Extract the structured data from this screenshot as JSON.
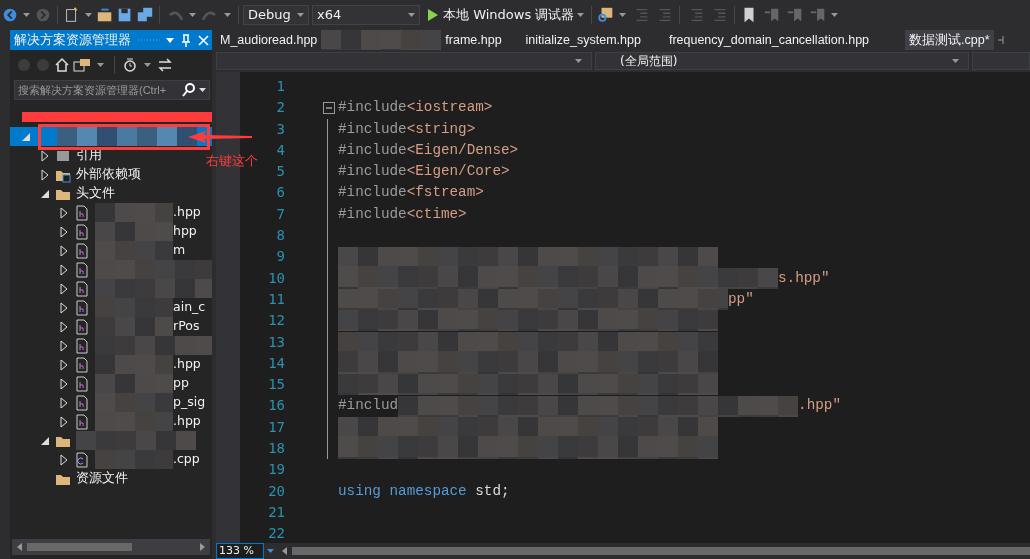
{
  "toolbar": {
    "configuration": "Debug",
    "platform": "x64",
    "run_label": "本地 Windows 调试器"
  },
  "solution_explorer": {
    "title": "解决方案资源管理器",
    "search": {
      "placeholder": "搜索解决方案资源管理器(Ctrl+"
    },
    "tree": [
      {
        "redacted": true,
        "selected": true,
        "expanded": true,
        "kind": "project",
        "children": [
          {
            "label": "引用",
            "kind": "references",
            "expanded": false,
            "selected": false
          },
          {
            "label": "外部依赖项",
            "kind": "external",
            "expanded": false,
            "selected": false
          },
          {
            "label": "头文件",
            "kind": "folder",
            "expanded": true,
            "selected": false,
            "children": [
              {
                "redacted": true,
                "suffix": ".hpp",
                "kind": "header",
                "expanded": false,
                "selected": false
              },
              {
                "redacted": true,
                "suffix": "hpp",
                "kind": "header",
                "expanded": false,
                "selected": false
              },
              {
                "redacted": true,
                "suffix": "m",
                "kind": "header",
                "expanded": false,
                "selected": false
              },
              {
                "redacted": true,
                "kind": "header",
                "expanded": false,
                "selected": false
              },
              {
                "redacted": true,
                "kind": "header",
                "expanded": false,
                "selected": false
              },
              {
                "redacted": true,
                "suffix": "ain_c",
                "kind": "header",
                "expanded": false,
                "selected": false
              },
              {
                "redacted": true,
                "suffix": "rPos",
                "kind": "header",
                "expanded": false,
                "selected": false
              },
              {
                "redacted": true,
                "kind": "header",
                "expanded": false,
                "selected": false
              },
              {
                "redacted": true,
                "suffix": ".hpp",
                "kind": "header",
                "expanded": false,
                "selected": false
              },
              {
                "redacted": true,
                "suffix": "pp",
                "kind": "header",
                "expanded": false,
                "selected": false
              },
              {
                "redacted": true,
                "suffix": "p_sig",
                "kind": "header",
                "expanded": false,
                "selected": false
              },
              {
                "redacted": true,
                "suffix": ".hpp",
                "kind": "header",
                "expanded": false,
                "selected": false
              }
            ]
          },
          {
            "redacted": true,
            "kind": "folder",
            "expanded": true,
            "selected": false,
            "children": [
              {
                "redacted": true,
                "suffix": ".cpp",
                "kind": "source",
                "expanded": false,
                "selected": false
              }
            ]
          },
          {
            "label": "资源文件",
            "kind": "folder",
            "selected": false
          }
        ]
      }
    ]
  },
  "annotation": {
    "text": "右键这个"
  },
  "tabs": [
    {
      "label": "M_audioread.hpp",
      "selected": false
    },
    {
      "label": "frame.hpp",
      "redacted": true,
      "selected": false
    },
    {
      "label": "initialize_system.hpp",
      "selected": false
    },
    {
      "label": "frequency_domain_cancellation.hpp",
      "selected": false
    },
    {
      "label": "数据测试.cpp*",
      "selected": true
    }
  ],
  "nav_bar": {
    "scope": "(全局范围)"
  },
  "code_lines": [
    {
      "number": "1",
      "kind": "plain"
    },
    {
      "number": "2",
      "kind": "fold-start",
      "tokens": [
        {
          "kind": "directive",
          "text": "#include"
        },
        {
          "kind": "string",
          "text": "<iostream>"
        }
      ]
    },
    {
      "number": "3",
      "kind": "fold-body",
      "tokens": [
        {
          "kind": "directive",
          "text": "#include"
        },
        {
          "kind": "string",
          "text": "<string>"
        }
      ]
    },
    {
      "number": "4",
      "kind": "fold-body",
      "tokens": [
        {
          "kind": "directive",
          "text": "#include"
        },
        {
          "kind": "string",
          "text": "<Eigen/Dense>"
        }
      ]
    },
    {
      "number": "5",
      "kind": "fold-body",
      "tokens": [
        {
          "kind": "directive",
          "text": "#include"
        },
        {
          "kind": "string",
          "text": "<Eigen/Core>"
        }
      ]
    },
    {
      "number": "6",
      "kind": "fold-body",
      "tokens": [
        {
          "kind": "directive",
          "text": "#include"
        },
        {
          "kind": "string",
          "text": "<fstream>"
        }
      ]
    },
    {
      "number": "7",
      "kind": "fold-body",
      "tokens": [
        {
          "kind": "directive",
          "text": "#include"
        },
        {
          "kind": "string",
          "text": "<ctime>"
        }
      ]
    },
    {
      "number": "8",
      "kind": "fold-body"
    },
    {
      "number": "9",
      "kind": "fold-body",
      "redacted": true
    },
    {
      "number": "10",
      "kind": "fold-body",
      "redacted": true,
      "tokens": [
        {
          "kind": "string",
          "text": "s.hpp\""
        }
      ]
    },
    {
      "number": "11",
      "kind": "fold-body",
      "redacted": true,
      "tokens": [
        {
          "kind": "string",
          "text": "pp\""
        }
      ]
    },
    {
      "number": "12",
      "kind": "fold-body",
      "redacted": true
    },
    {
      "number": "13",
      "kind": "fold-body",
      "redacted": true
    },
    {
      "number": "14",
      "kind": "fold-body",
      "redacted": true
    },
    {
      "number": "15",
      "kind": "fold-body",
      "redacted": true
    },
    {
      "number": "16",
      "kind": "fold-body",
      "prefix": [
        {
          "kind": "directive",
          "text": "#includ"
        }
      ],
      "redacted": true,
      "tokens": [
        {
          "kind": "string",
          "text": ".hpp\""
        }
      ]
    },
    {
      "number": "17",
      "kind": "fold-body",
      "redacted": true
    },
    {
      "number": "18",
      "kind": "fold-body",
      "redacted": true
    },
    {
      "number": "19",
      "kind": "plain"
    },
    {
      "number": "20",
      "kind": "plain",
      "tokens": [
        {
          "kind": "keyword",
          "text": "using"
        },
        {
          "kind": "keyword",
          "text": " namespace"
        },
        {
          "kind": "plain",
          "text": " std;"
        }
      ]
    },
    {
      "number": "21",
      "kind": "plain"
    },
    {
      "number": "22",
      "kind": "plain"
    }
  ],
  "status": {
    "zoom": "133 %"
  }
}
